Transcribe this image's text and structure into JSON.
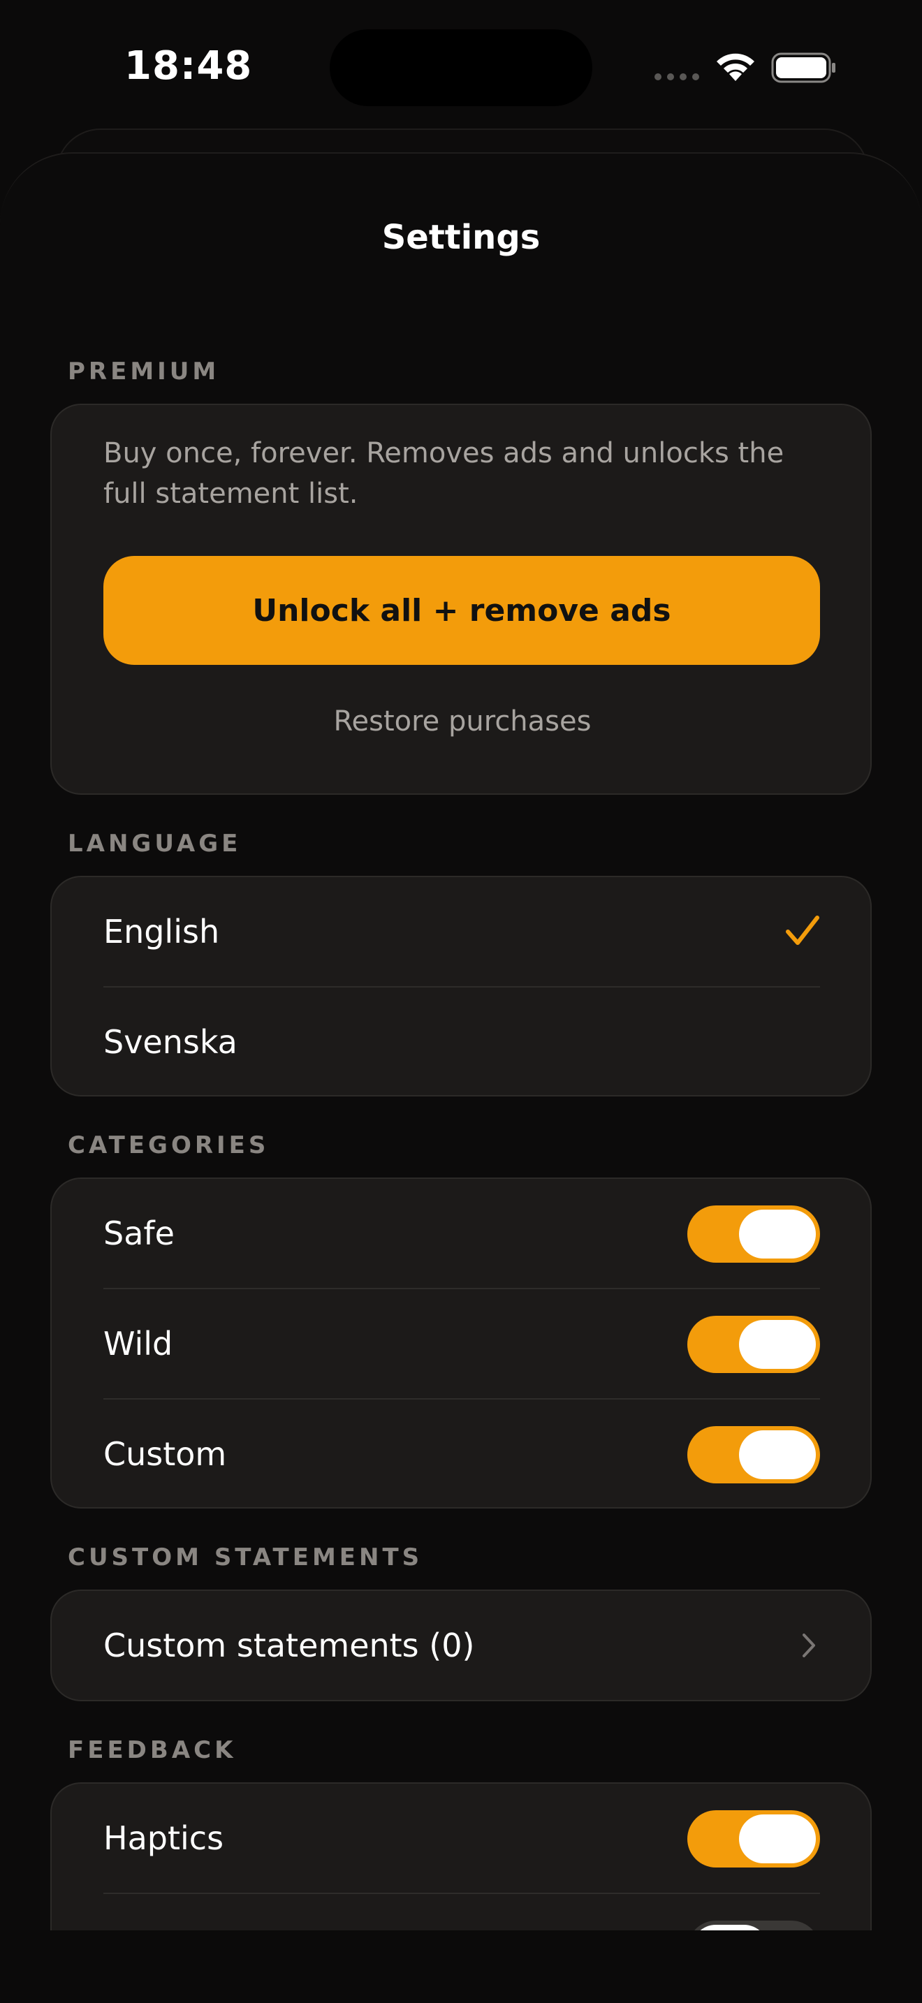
{
  "status_bar": {
    "time": "18:48"
  },
  "sheet": {
    "title": "Settings"
  },
  "premium": {
    "header": "PREMIUM",
    "description": "Buy once, forever. Removes ads and unlocks the full statement list.",
    "unlock_label": "Unlock all + remove ads",
    "restore_label": "Restore purchases"
  },
  "language": {
    "header": "LANGUAGE",
    "items": [
      {
        "label": "English",
        "selected": true
      },
      {
        "label": "Svenska",
        "selected": false
      }
    ]
  },
  "categories": {
    "header": "CATEGORIES",
    "items": [
      {
        "label": "Safe",
        "on": true
      },
      {
        "label": "Wild",
        "on": true
      },
      {
        "label": "Custom",
        "on": true
      }
    ]
  },
  "custom_statements": {
    "header": "CUSTOM STATEMENTS",
    "row_label": "Custom statements (0)"
  },
  "feedback": {
    "header": "FEEDBACK",
    "items": [
      {
        "label": "Haptics",
        "on": true
      },
      {
        "label": "",
        "on": false
      }
    ]
  },
  "colors": {
    "accent": "#f39c0b",
    "card": "#1c1a19",
    "background": "#0b0a0a",
    "secondary_text": "#a8a4a0"
  },
  "icons": {
    "selected": "check-icon",
    "navigate": "chevron-right-icon",
    "wifi": "wifi-icon",
    "battery": "battery-icon"
  }
}
